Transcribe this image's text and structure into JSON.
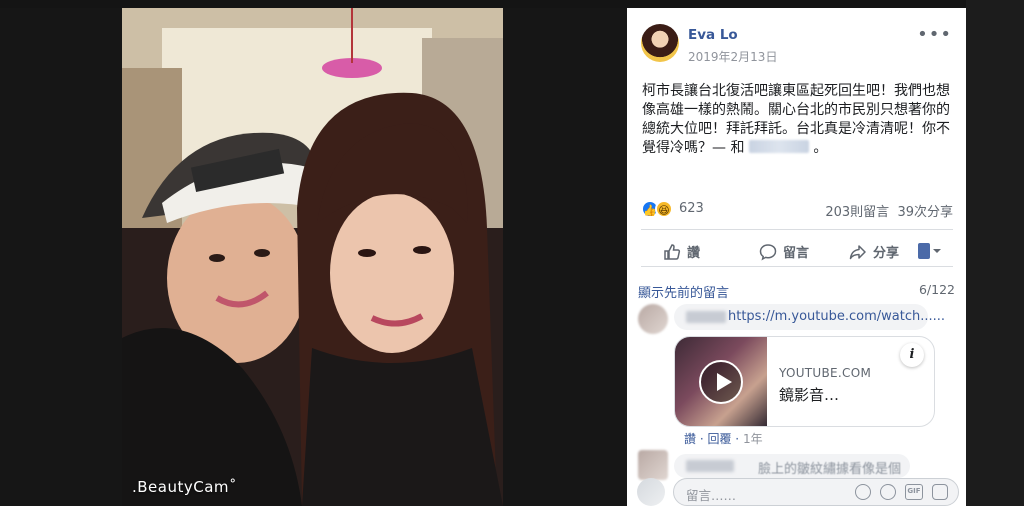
{
  "photo": {
    "watermark": ".BeautyCam˚"
  },
  "post": {
    "author": "Eva Lo",
    "date": "2019年2月13日",
    "more_icon": "more-horizontal-icon",
    "body": "柯市長讓台北復活吧讓東區起死回生吧！我們也想像高雄一樣的熱鬧。關心台北的市民別只想著你的總統大位吧！拜託拜託。台北真是冷清清呢！你不覺得冷嗎？— 和",
    "body_end": "。",
    "reaction_count": "623",
    "comment_count": "203則留言",
    "share_count": "39次分享",
    "colors": {
      "link": "#385898",
      "like_blue": "#1877f2",
      "haha_yellow": "#f7b928"
    }
  },
  "actions": {
    "like": "讚",
    "comment": "留言",
    "share": "分享"
  },
  "comments": {
    "show_previous": "顯示先前的留言",
    "count": "6/122",
    "first": {
      "link": "https://m.youtube.com/watch......",
      "card_site": "YOUTUBE.COM",
      "card_title": "鏡影音…",
      "info": "i",
      "like": "讚",
      "reply": "回覆",
      "time": "1年"
    },
    "second": {
      "text": "臉上的皺紋繡據看像是個倉文"
    },
    "composer_placeholder": "留言……"
  }
}
